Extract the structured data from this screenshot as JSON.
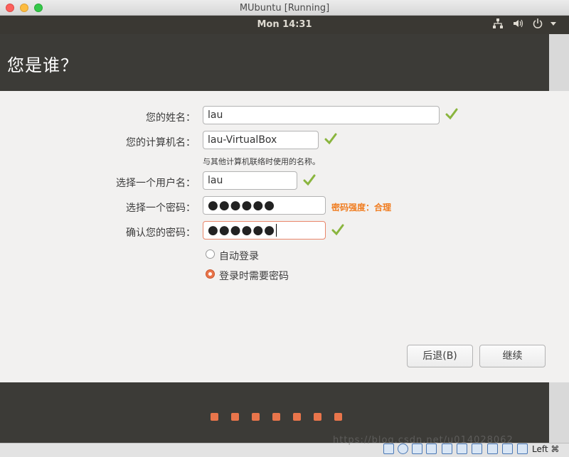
{
  "window": {
    "title": "MUbuntu [Running]"
  },
  "panel": {
    "clock": "Mon 14:31",
    "icons": [
      "network-icon",
      "volume-icon",
      "power-icon",
      "menu-arrow-icon"
    ]
  },
  "page": {
    "title": "您是谁？"
  },
  "form": {
    "name_label": "您的姓名：",
    "name_value": "lau",
    "computer_label": "您的计算机名：",
    "computer_value": "lau-VirtualBox",
    "computer_hint": "与其他计算机联络时使用的名称。",
    "username_label": "选择一个用户名：",
    "username_value": "lau",
    "password_label": "选择一个密码：",
    "password_value": "●●●●●●",
    "password_strength": "密码强度：合理",
    "confirm_label": "确认您的密码：",
    "confirm_value": "●●●●●●"
  },
  "login": {
    "auto_label": "自动登录",
    "require_label": "登录时需要密码",
    "selected": "require"
  },
  "buttons": {
    "back": "后退(B)",
    "continue": "继续"
  },
  "progress": {
    "total_dots": 7
  },
  "statusbar": {
    "host_key": "Left ⌘",
    "watermark": "https://blog.csdn.net/u014028062"
  },
  "colors": {
    "accent": "#e9754b",
    "check": "#8ab53e",
    "strength": "#f07c1f"
  }
}
